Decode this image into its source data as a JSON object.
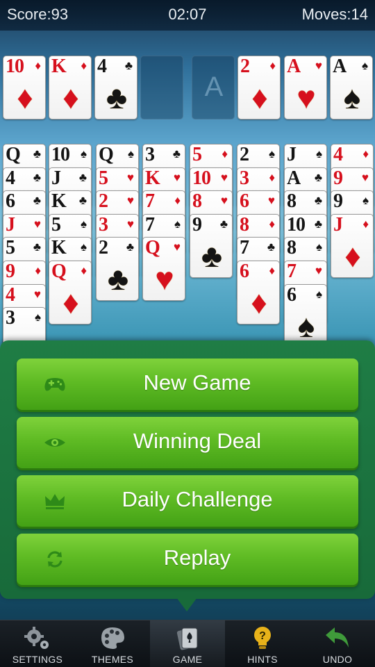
{
  "status": {
    "score": "Score:93",
    "time": "02:07",
    "moves": "Moves:14"
  },
  "foundation": [
    {
      "rank": "10",
      "suit": "♦",
      "color": "red"
    },
    {
      "rank": "K",
      "suit": "♦",
      "color": "red"
    },
    {
      "rank": "4",
      "suit": "♣",
      "color": "black"
    },
    {
      "empty": true,
      "ghost": ""
    },
    {
      "empty": true,
      "ghost": "A"
    },
    {
      "rank": "2",
      "suit": "♦",
      "color": "red"
    },
    {
      "rank": "A",
      "suit": "♥",
      "color": "red"
    },
    {
      "rank": "A",
      "suit": "♠",
      "color": "black"
    }
  ],
  "tableau": [
    [
      [
        "Q",
        "♣",
        "black"
      ],
      [
        "4",
        "♣",
        "black"
      ],
      [
        "6",
        "♣",
        "black"
      ],
      [
        "J",
        "♥",
        "red"
      ],
      [
        "5",
        "♣",
        "black"
      ],
      [
        "9",
        "♦",
        "red"
      ],
      [
        "4",
        "♥",
        "red"
      ],
      [
        "3",
        "♠",
        "black"
      ]
    ],
    [
      [
        "10",
        "♠",
        "black"
      ],
      [
        "J",
        "♣",
        "black"
      ],
      [
        "K",
        "♣",
        "black"
      ],
      [
        "5",
        "♠",
        "black"
      ],
      [
        "K",
        "♠",
        "black"
      ],
      [
        "Q",
        "♦",
        "red"
      ]
    ],
    [
      [
        "Q",
        "♠",
        "black"
      ],
      [
        "5",
        "♥",
        "red"
      ],
      [
        "2",
        "♥",
        "red"
      ],
      [
        "3",
        "♥",
        "red"
      ],
      [
        "2",
        "♣",
        "black"
      ]
    ],
    [
      [
        "3",
        "♣",
        "black"
      ],
      [
        "K",
        "♥",
        "red"
      ],
      [
        "7",
        "♦",
        "red"
      ],
      [
        "7",
        "♠",
        "black"
      ],
      [
        "Q",
        "♥",
        "red"
      ]
    ],
    [
      [
        "5",
        "♦",
        "red"
      ],
      [
        "10",
        "♥",
        "red"
      ],
      [
        "8",
        "♥",
        "red"
      ],
      [
        "9",
        "♣",
        "black"
      ]
    ],
    [
      [
        "2",
        "♠",
        "black"
      ],
      [
        "3",
        "♦",
        "red"
      ],
      [
        "6",
        "♥",
        "red"
      ],
      [
        "8",
        "♦",
        "red"
      ],
      [
        "7",
        "♣",
        "black"
      ],
      [
        "6",
        "♦",
        "red"
      ]
    ],
    [
      [
        "J",
        "♠",
        "black"
      ],
      [
        "A",
        "♣",
        "black"
      ],
      [
        "8",
        "♣",
        "black"
      ],
      [
        "10",
        "♣",
        "black"
      ],
      [
        "8",
        "♠",
        "black"
      ],
      [
        "7",
        "♥",
        "red"
      ],
      [
        "6",
        "♠",
        "black"
      ]
    ],
    [
      [
        "4",
        "♦",
        "red"
      ],
      [
        "9",
        "♥",
        "red"
      ],
      [
        "9",
        "♠",
        "black"
      ],
      [
        "J",
        "♦",
        "red"
      ]
    ]
  ],
  "menu": {
    "items": [
      {
        "label": "New Game",
        "icon": "gamepad-icon"
      },
      {
        "label": "Winning Deal",
        "icon": "eye-icon"
      },
      {
        "label": "Daily Challenge",
        "icon": "crown-icon"
      },
      {
        "label": "Replay",
        "icon": "refresh-icon"
      }
    ]
  },
  "toolbar": {
    "items": [
      {
        "label": "SETTINGS",
        "icon": "gears-icon"
      },
      {
        "label": "THEMES",
        "icon": "palette-icon"
      },
      {
        "label": "GAME",
        "icon": "cards-icon",
        "active": true
      },
      {
        "label": "HINTS",
        "icon": "lightbulb-icon"
      },
      {
        "label": "UNDO",
        "icon": "undo-arrow-icon"
      }
    ]
  },
  "colors": {
    "menu_bg": "#1f7d45",
    "button_green": "#5fbb24",
    "red_suit": "#d6101d",
    "black_suit": "#141414",
    "undo_green": "#3f9a3a",
    "hint_yellow": "#e8b21a"
  }
}
